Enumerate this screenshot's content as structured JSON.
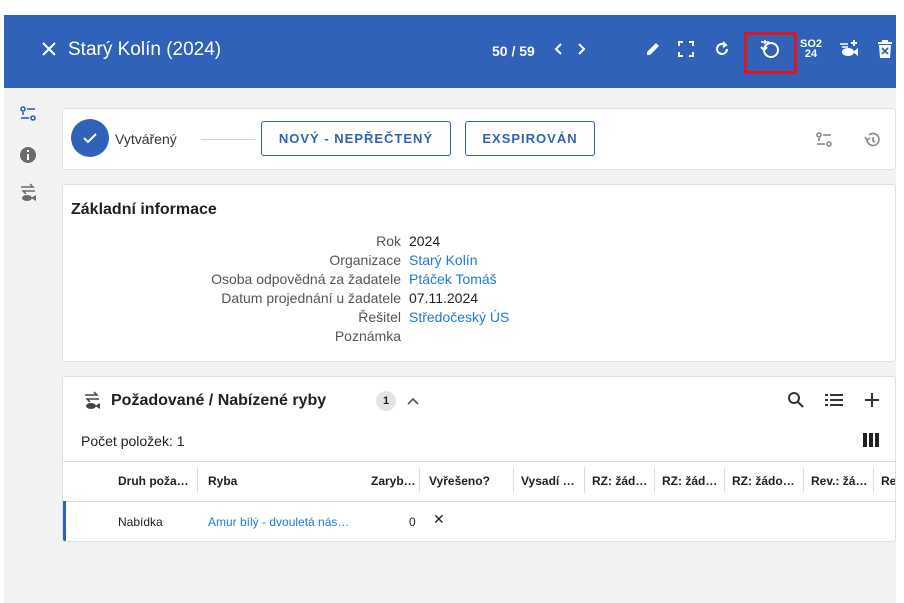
{
  "header": {
    "title": "Starý Kolín (2024)",
    "counter": "50 / 59",
    "code_icon_text": [
      "SO2",
      "24"
    ]
  },
  "status": {
    "state_label": "Vytvářený",
    "btn_new": "NOVÝ - NEPŘEČTENÝ",
    "btn_expired": "EXSPIROVÁN"
  },
  "info": {
    "title": "Základní informace",
    "rows": [
      {
        "label": "Rok",
        "value": "2024"
      },
      {
        "label": "Organizace",
        "value": "Starý Kolín"
      },
      {
        "label": "Osoba odpovědná za žadatele",
        "value": "Ptáček Tomáš"
      },
      {
        "label": "Datum projednání u žadatele",
        "value": "07.11.2024"
      },
      {
        "label": "Řešitel",
        "value": "Středočeský ÚS"
      },
      {
        "label": "Poznámka",
        "value": ""
      }
    ]
  },
  "fish": {
    "title": "Požadované / Nabízené ryby",
    "badge": "1",
    "count_label": "Počet položek: 1",
    "columns": [
      "Druh poža…",
      "Ryba",
      "Zaryb…",
      "Vyřešeno?",
      "Vysadí …",
      "RZ: žád…",
      "RZ: žád…",
      "RZ: žádo…",
      "Rev.: žá…",
      "Re"
    ],
    "row": {
      "druh": "Nabídka",
      "ryba": "Amur bílý - dvouletá nás…",
      "zaryb": "0",
      "vyreseno": "✕"
    }
  },
  "colors": {
    "primary": "#2f62b8",
    "link": "#1e7ad1",
    "highlight": "#e2141d"
  }
}
